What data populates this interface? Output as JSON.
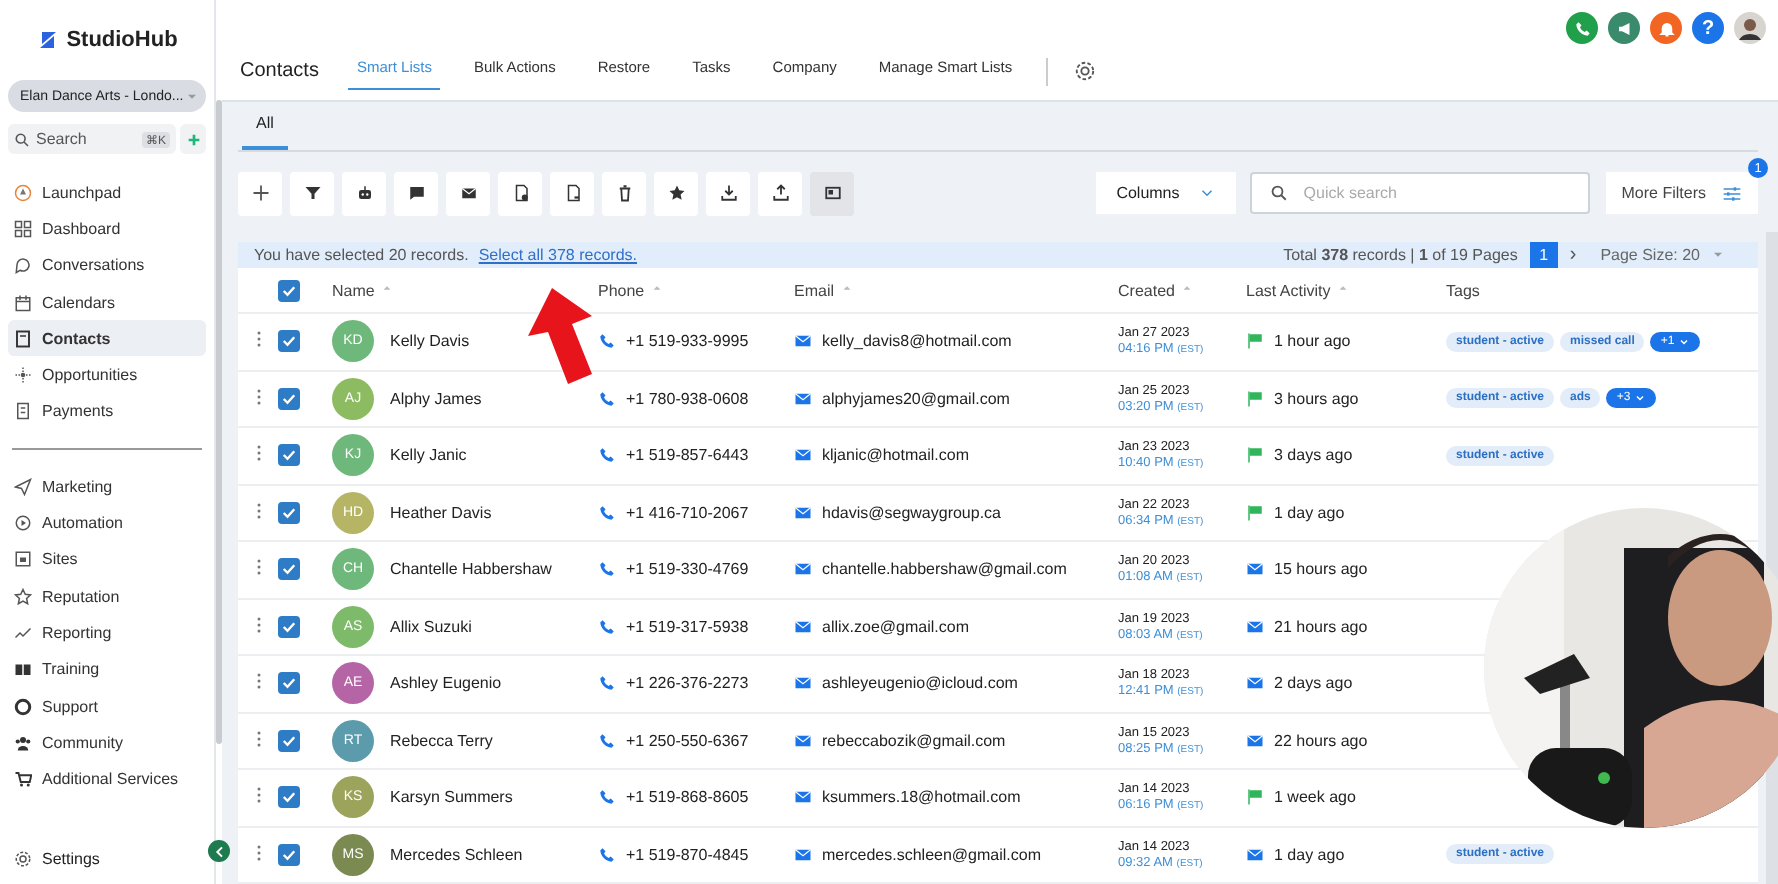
{
  "sidebar": {
    "logo": "StudioHub",
    "account": "Elan Dance Arts - Londo...",
    "search": {
      "placeholder": "Search",
      "shortcut": "⌘K"
    },
    "groups": [
      [
        {
          "label": "Launchpad",
          "selected": false
        },
        {
          "label": "Dashboard",
          "selected": false
        },
        {
          "label": "Conversations",
          "selected": false
        },
        {
          "label": "Calendars",
          "selected": false
        },
        {
          "label": "Contacts",
          "selected": true
        },
        {
          "label": "Opportunities",
          "selected": false
        },
        {
          "label": "Payments",
          "selected": false
        }
      ],
      [
        {
          "label": "Marketing",
          "selected": false
        },
        {
          "label": "Automation",
          "selected": false
        },
        {
          "label": "Sites",
          "selected": false
        },
        {
          "label": "Reputation",
          "selected": false
        },
        {
          "label": "Reporting",
          "selected": false
        },
        {
          "label": "Training",
          "selected": false
        },
        {
          "label": "Support",
          "selected": false
        },
        {
          "label": "Community",
          "selected": false
        },
        {
          "label": "Additional Services",
          "selected": false
        }
      ]
    ],
    "settings": "Settings"
  },
  "header": {
    "title": "Contacts",
    "tabs": [
      {
        "label": "Smart Lists",
        "selected": true
      },
      {
        "label": "Bulk Actions",
        "selected": false
      },
      {
        "label": "Restore",
        "selected": false
      },
      {
        "label": "Tasks",
        "selected": false
      },
      {
        "label": "Company",
        "selected": false
      },
      {
        "label": "Manage Smart Lists",
        "selected": false
      }
    ],
    "help": "?"
  },
  "list_tabs": [
    {
      "label": "All",
      "selected": true
    }
  ],
  "toolbar": [
    {
      "active": false
    },
    {
      "active": false
    },
    {
      "active": false
    },
    {
      "active": false
    },
    {
      "active": false
    },
    {
      "active": false
    },
    {
      "active": false
    },
    {
      "active": false
    },
    {
      "active": false
    },
    {
      "active": false
    },
    {
      "active": false
    },
    {
      "active": true
    }
  ],
  "columns_button": "Columns",
  "quick_search": {
    "placeholder": "Quick search"
  },
  "more_filters": {
    "label": "More Filters",
    "badge": "1"
  },
  "selection": {
    "text": "You have selected 20 records.",
    "link": "Select all 378 records."
  },
  "pagination": {
    "summary": "Total **378** records | **1** of 19 Pages",
    "pages": [
      {
        "label": "1",
        "selected": true
      }
    ],
    "next": "›",
    "page_size": "Page Size: 20"
  },
  "table": {
    "columns": [
      "Name",
      "Phone",
      "Email",
      "Created",
      "Last Activity",
      "Tags"
    ],
    "all_checked": true,
    "rows": [
      {
        "checked": true,
        "initials": "KD",
        "color": "#6db87a",
        "name": "Kelly Davis",
        "phone": "+1 519-933-9995",
        "email": "kelly_davis8@hotmail.com",
        "date": "Jan 27 2023",
        "time": "04:16 PM",
        "tz": "(EST)",
        "activity": {
          "kind": "sms",
          "text": "1 hour ago"
        },
        "tags": [
          {
            "kind": "tag",
            "label": "student - active"
          },
          {
            "kind": "tag",
            "label": "missed call"
          },
          {
            "kind": "more",
            "label": "+1"
          }
        ]
      },
      {
        "checked": true,
        "initials": "AJ",
        "color": "#8dbb62",
        "name": "Alphy James",
        "phone": "+1 780-938-0608",
        "email": "alphyjames20@gmail.com",
        "date": "Jan 25 2023",
        "time": "03:20 PM",
        "tz": "(EST)",
        "activity": {
          "kind": "sms",
          "text": "3 hours ago"
        },
        "tags": [
          {
            "kind": "tag",
            "label": "student - active"
          },
          {
            "kind": "tag",
            "label": "ads"
          },
          {
            "kind": "more",
            "label": "+3"
          }
        ]
      },
      {
        "checked": true,
        "initials": "KJ",
        "color": "#6db87a",
        "name": "Kelly Janic",
        "phone": "+1 519-857-6443",
        "email": "kljanic@hotmail.com",
        "date": "Jan 23 2023",
        "time": "10:40 PM",
        "tz": "(EST)",
        "activity": {
          "kind": "sms",
          "text": "3 days ago"
        },
        "tags": [
          {
            "kind": "tag",
            "label": "student - active"
          }
        ]
      },
      {
        "checked": true,
        "initials": "HD",
        "color": "#b5b565",
        "name": "Heather Davis",
        "phone": "+1 416-710-2067",
        "email": "hdavis@segwaygroup.ca",
        "date": "Jan 22 2023",
        "time": "06:34 PM",
        "tz": "(EST)",
        "activity": {
          "kind": "sms",
          "text": "1 day ago"
        },
        "tags": []
      },
      {
        "checked": true,
        "initials": "CH",
        "color": "#6db87a",
        "name": "Chantelle Habbershaw",
        "phone": "+1 519-330-4769",
        "email": "chantelle.habbershaw@gmail.com",
        "date": "Jan 20 2023",
        "time": "01:08 AM",
        "tz": "(EST)",
        "activity": {
          "kind": "email",
          "text": "15 hours ago"
        },
        "tags": []
      },
      {
        "checked": true,
        "initials": "AS",
        "color": "#7dba6a",
        "name": "Allix Suzuki",
        "phone": "+1 519-317-5938",
        "email": "allix.zoe@gmail.com",
        "date": "Jan 19 2023",
        "time": "08:03 AM",
        "tz": "(EST)",
        "activity": {
          "kind": "email",
          "text": "21 hours ago"
        },
        "tags": []
      },
      {
        "checked": true,
        "initials": "AE",
        "color": "#b565a6",
        "name": "Ashley Eugenio",
        "phone": "+1 226-376-2273",
        "email": "ashleyeugenio@icloud.com",
        "date": "Jan 18 2023",
        "time": "12:41 PM",
        "tz": "(EST)",
        "activity": {
          "kind": "email",
          "text": "2 days ago"
        },
        "tags": []
      },
      {
        "checked": true,
        "initials": "RT",
        "color": "#5b9bab",
        "name": "Rebecca Terry",
        "phone": "+1 250-550-6367",
        "email": "rebeccabozik@gmail.com",
        "date": "Jan 15 2023",
        "time": "08:25 PM",
        "tz": "(EST)",
        "activity": {
          "kind": "email",
          "text": "22 hours ago"
        },
        "tags": []
      },
      {
        "checked": true,
        "initials": "KS",
        "color": "#9ba45a",
        "name": "Karsyn Summers",
        "phone": "+1 519-868-8605",
        "email": "ksummers.18@hotmail.com",
        "date": "Jan 14 2023",
        "time": "06:16 PM",
        "tz": "(EST)",
        "activity": {
          "kind": "sms",
          "text": "1 week ago"
        },
        "tags": []
      },
      {
        "checked": true,
        "initials": "MS",
        "color": "#7b8a50",
        "name": "Mercedes Schleen",
        "phone": "+1 519-870-4845",
        "email": "mercedes.schleen@gmail.com",
        "date": "Jan 14 2023",
        "time": "09:32 AM",
        "tz": "(EST)",
        "activity": {
          "kind": "email",
          "text": "1 day ago"
        },
        "tags": [
          {
            "kind": "tag",
            "label": "student - active"
          }
        ]
      }
    ]
  }
}
